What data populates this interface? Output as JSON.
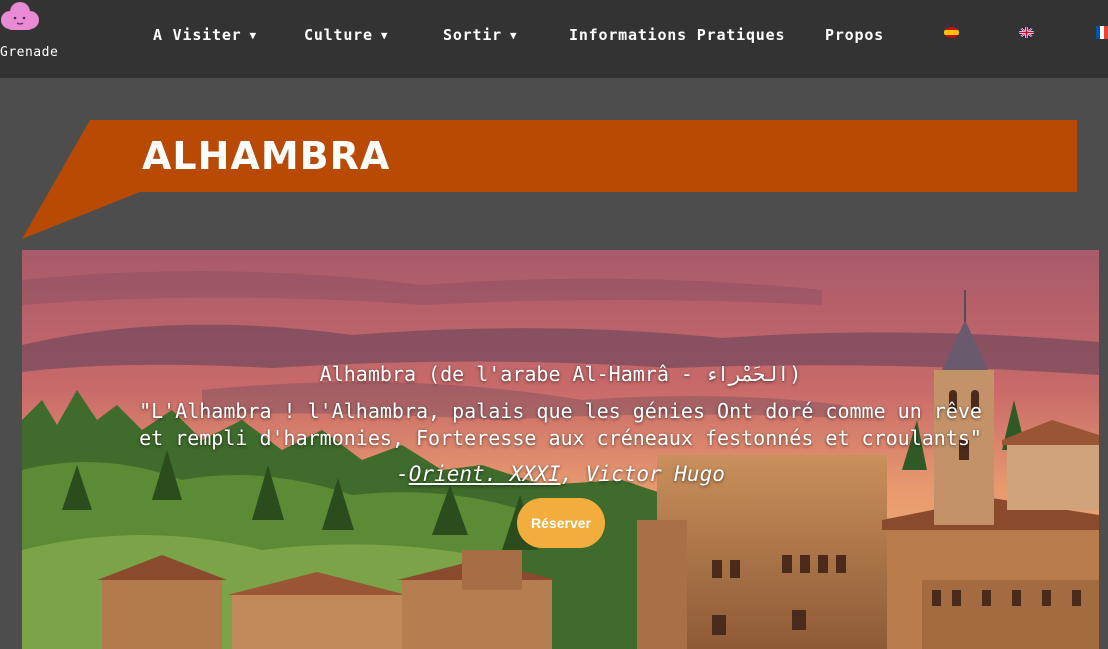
{
  "brand": {
    "name": "Grenade",
    "logo_icon": "pink-cloud-icon"
  },
  "nav": {
    "items": [
      {
        "label": "A Visiter",
        "dropdown": true
      },
      {
        "label": "Culture",
        "dropdown": true
      },
      {
        "label": "Sortir",
        "dropdown": true
      },
      {
        "label": "Informations Pratiques",
        "dropdown": false
      },
      {
        "label": "Propos",
        "dropdown": false
      }
    ],
    "caret": "▼",
    "languages": [
      "es-flag-icon",
      "uk-flag-icon",
      "fr-flag-icon"
    ]
  },
  "banner": {
    "title": "ALHAMBRA",
    "color": "#b84a04"
  },
  "hero": {
    "subtitle": "Alhambra (de l'arabe Al-Hamrâ - الحَمْراء)",
    "quote_line1": "\"L'Alhambra ! l'Alhambra, palais que les génies Ont doré comme un rêve",
    "quote_line2": "et rempli d'harmonies, Forteresse aux créneaux festonnés et croulants\"",
    "author_prefix": "-",
    "author_work": "Orient. XXXI",
    "author_name": ", Victor Hugo",
    "button_label": "Réserver",
    "button_color": "#f2ad3c"
  }
}
